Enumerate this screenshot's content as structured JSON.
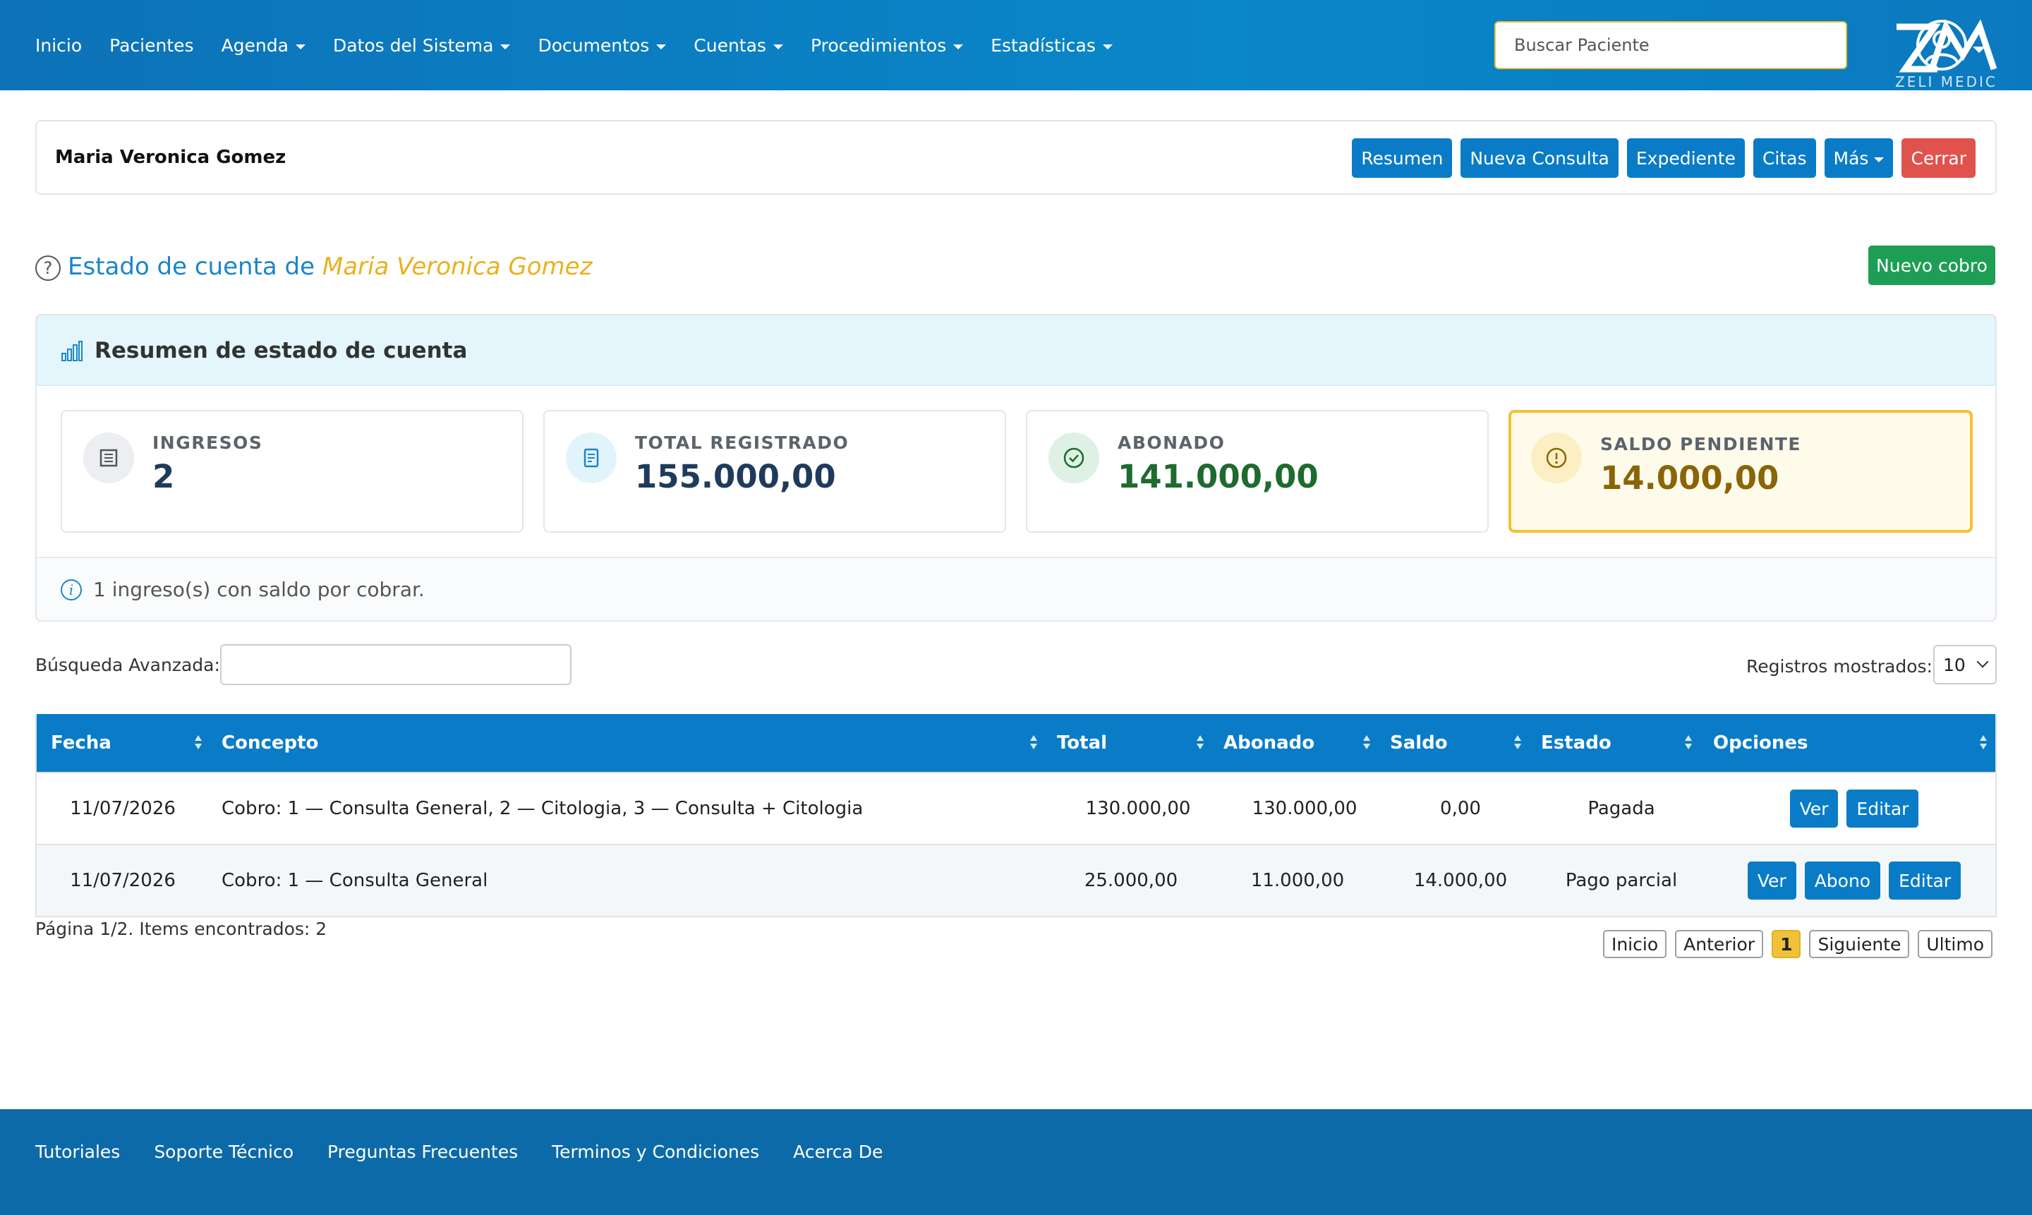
{
  "navbar": {
    "items": [
      {
        "label": "Inicio",
        "dropdown": false
      },
      {
        "label": "Pacientes",
        "dropdown": false
      },
      {
        "label": "Agenda",
        "dropdown": true
      },
      {
        "label": "Datos del Sistema",
        "dropdown": true
      },
      {
        "label": "Documentos",
        "dropdown": true
      },
      {
        "label": "Cuentas",
        "dropdown": true
      },
      {
        "label": "Procedimientos",
        "dropdown": true
      },
      {
        "label": "Estadísticas",
        "dropdown": true
      }
    ],
    "search_placeholder": "Buscar Paciente",
    "user_icon": "user-avatar-icon"
  },
  "patient_bar": {
    "name": "Maria Veronica Gomez",
    "buttons": {
      "resumen": "Resumen",
      "nueva_consulta": "Nueva Consulta",
      "expediente": "Expediente",
      "citas": "Citas",
      "mas": "Más",
      "cerrar": "Cerrar"
    }
  },
  "page": {
    "title_prefix": "Estado de cuenta de",
    "title_patient": "Maria Veronica Gomez",
    "help_icon": "?",
    "new_charge": "Nuevo cobro"
  },
  "summary": {
    "title": "Resumen de estado de cuenta",
    "stats": [
      {
        "label": "INGRESOS",
        "value": "2",
        "icon": "document-list-icon",
        "color": "#1f3b5c"
      },
      {
        "label": "TOTAL REGISTRADO",
        "value": "155.000,00",
        "icon": "receipt-icon",
        "color": "#1f3b5c"
      },
      {
        "label": "ABONADO",
        "value": "141.000,00",
        "icon": "check-circle-icon",
        "color": "#1e6b2e"
      },
      {
        "label": "SALDO PENDIENTE",
        "value": "14.000,00",
        "icon": "warning-circle-icon",
        "color": "#8a6508"
      }
    ],
    "info": "1 ingreso(s) con saldo por cobrar."
  },
  "filters": {
    "advanced_label": "Búsqueda Avanzada:",
    "advanced_value": "",
    "rows_label": "Registros mostrados:",
    "rows_value": "10"
  },
  "table": {
    "headers": {
      "fecha": "Fecha",
      "concepto": "Concepto",
      "total": "Total",
      "abonado": "Abonado",
      "saldo": "Saldo",
      "estado": "Estado",
      "opciones": "Opciones"
    },
    "rows": [
      {
        "fecha": "11/07/2026",
        "concepto": "Cobro: 1 — Consulta General, 2 — Citologia, 3 — Consulta + Citologia",
        "total": "130.000,00",
        "abonado": "130.000,00",
        "saldo": "0,00",
        "estado": "Pagada",
        "opciones": {
          "ver": "Ver",
          "editar": "Editar"
        }
      },
      {
        "fecha": "11/07/2026",
        "concepto": "Cobro: 1 — Consulta General",
        "total": "25.000,00",
        "abonado": "11.000,00",
        "saldo": "14.000,00",
        "estado": "Pago parcial",
        "opciones": {
          "ver": "Ver",
          "abono": "Abono",
          "editar": "Editar"
        }
      }
    ]
  },
  "pagination": {
    "info": "Página 1/2. Items encontrados: 2",
    "first": "Inicio",
    "prev": "Anterior",
    "current": "1",
    "next": "Siguiente",
    "last": "Ultimo"
  },
  "footer": {
    "links": [
      "Tutoriales",
      "Soporte Técnico",
      "Preguntas Frecuentes",
      "Terminos y Condiciones",
      "Acerca De"
    ],
    "brand": "ZELI MEDIC"
  },
  "colors": {
    "primary": "#0a7cc7",
    "danger": "#e0524c",
    "success": "#1e9e55",
    "warning": "#f2c230"
  }
}
